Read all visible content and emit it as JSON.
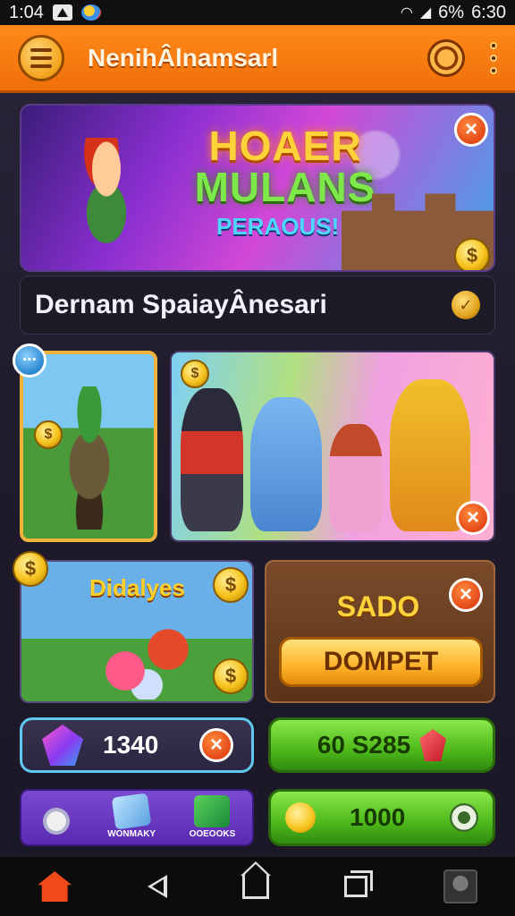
{
  "status_bar": {
    "time_left": "1:04",
    "battery": "6%",
    "clock": "6:30"
  },
  "app_bar": {
    "title": "NenihÂlnamsarl"
  },
  "hero": {
    "title_line1": "HOAER",
    "title_line2": "MULANS",
    "subtitle": "PERAOUS!"
  },
  "subheader": {
    "title": "Dernam SpaiayÂnesari"
  },
  "tile_bottom_left": {
    "title": "Didalyes"
  },
  "sado_panel": {
    "title": "SADO",
    "button_label": "DOMPET"
  },
  "resources": {
    "gems_value": "1340",
    "coins_value": "60 S285",
    "timer_value": "1000"
  },
  "bottom_panel": {
    "item1_label": "",
    "item2_label": "WONMAKY",
    "item3_label": "OOEOOKS"
  },
  "icons": {
    "close": "×",
    "coin_symbol": "$"
  },
  "colors": {
    "appbar": "#f07a12",
    "accent_gold": "#ffd23a",
    "accent_green": "#4eb81a",
    "close_red": "#e4491a"
  }
}
